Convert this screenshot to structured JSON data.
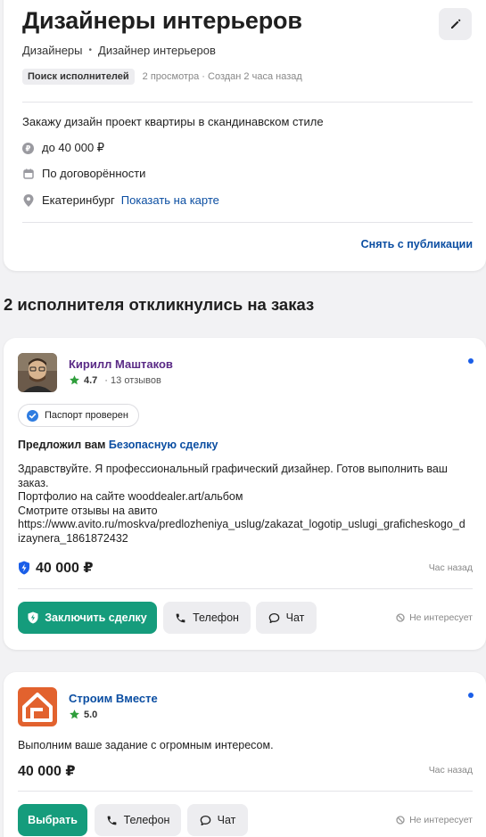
{
  "order": {
    "title": "Дизайнеры интерьеров",
    "breadcrumb": [
      "Дизайнеры",
      "Дизайнер интерьеров"
    ],
    "status": "Поиск исполнителей",
    "meta": "2 просмотра · Создан 2 часа назад",
    "description": "Закажу дизайн проект квартиры в скандинавском стиле",
    "budget": "до 40 000 ₽",
    "deadline": "По договорённости",
    "city": "Екатеринбург",
    "map_link": "Показать на карте",
    "unpublish_label": "Снять с публикации"
  },
  "responses_title": "2 исполнителя откликнулись на заказ",
  "responses": [
    {
      "name": "Кирилл Маштаков",
      "name_color": "#5a2a86",
      "rating": "4.7",
      "reviews": "13 отзывов",
      "passport": "Паспорт проверен",
      "offer_prefix": "Предложил вам ",
      "offer_link": "Безопасную сделку",
      "message": [
        "Здравствуйте. Я профессиональный графический дизайнер. Готов выполнить ваш",
        "заказ.",
        "Портфолио на сайте wooddealer.art/альбом",
        "Смотрите отзывы на авито",
        "https://www.avito.ru/moskva/predlozheniya_uslug/zakazat_logotip_uslugi_graficheskogo_d",
        "izaynera_1861872432"
      ],
      "price": "40 000 ₽",
      "time": "Час назад",
      "primary_label": "Заключить сделку",
      "phone_label": "Телефон",
      "chat_label": "Чат",
      "not_interested": "Не интересует"
    },
    {
      "name": "Строим Вместе",
      "name_color": "#0b4ea2",
      "rating": "5.0",
      "message": [
        "Выполним ваше задание с огромным интересом."
      ],
      "price": "40 000 ₽",
      "time": "Час назад",
      "primary_label": "Выбрать",
      "phone_label": "Телефон",
      "chat_label": "Чат",
      "not_interested": "Не интересует"
    }
  ],
  "colors": {
    "accent_green": "#159c7c",
    "link_blue": "#0b4ea2",
    "star_green": "#2e9e3b",
    "new_dot": "#1a5ee8"
  },
  "icons": [
    "edit-pencil-icon",
    "ruble-icon",
    "calendar-icon",
    "location-pin-icon",
    "star-icon",
    "check-badge-icon",
    "shield-icon",
    "phone-icon",
    "chat-icon",
    "block-icon"
  ]
}
